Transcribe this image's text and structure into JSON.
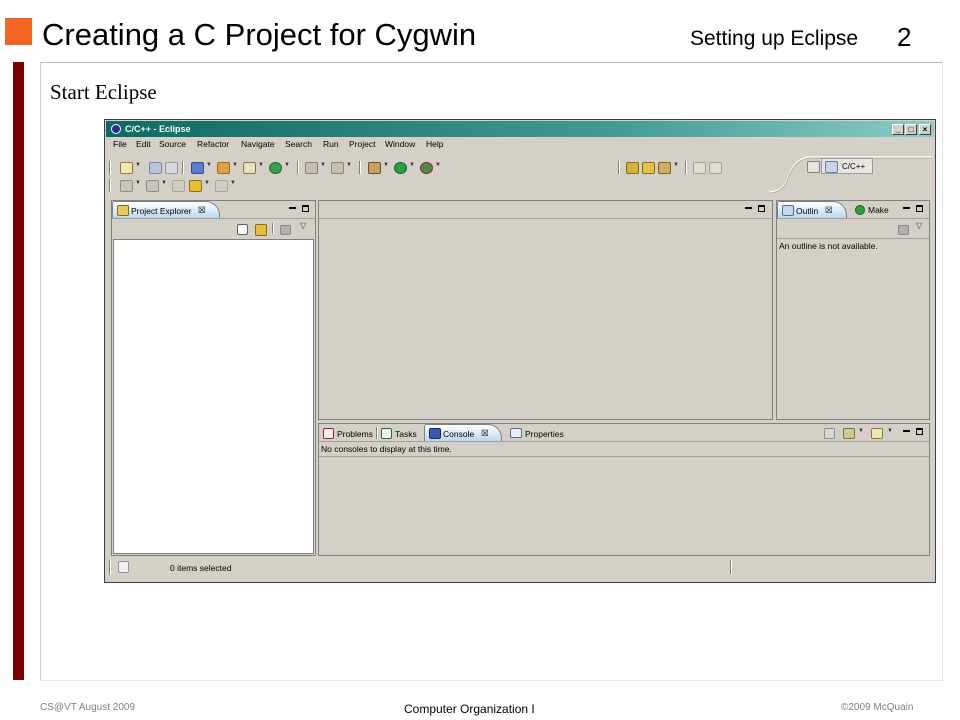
{
  "slide": {
    "title": "Creating a C Project for Cygwin",
    "topic": "Setting up Eclipse",
    "number": "2",
    "body": "Start Eclipse",
    "footer_left": "CS@VT August 2009",
    "footer_center": "Computer Organization I",
    "footer_right": "©2009  McQuain",
    "colors": {
      "accent_orange": "#f26522",
      "left_bar": "#7a0000"
    }
  },
  "window": {
    "title": "C/C++ - Eclipse",
    "title_icon": "eclipse-icon",
    "controls": {
      "minimize": "_",
      "maximize": "□",
      "close": "×"
    },
    "titlebar_color": "#0b6a61"
  },
  "menu": {
    "items": [
      "File",
      "Edit",
      "Source",
      "Refactor",
      "Navigate",
      "Search",
      "Run",
      "Project",
      "Window",
      "Help"
    ]
  },
  "perspective": {
    "label": "C/C++",
    "icon": "cpp-perspective-icon"
  },
  "project_explorer": {
    "tab": "Project Explorer",
    "close": "☒"
  },
  "outline": {
    "tab": "Outlin",
    "close": "☒",
    "message": "An outline is not available."
  },
  "make": {
    "tab": "Make"
  },
  "bottom_panel": {
    "tabs": [
      {
        "label": "Problems",
        "icon": "problems-icon"
      },
      {
        "label": "Tasks",
        "icon": "tasks-icon"
      },
      {
        "label": "Console",
        "icon": "console-icon",
        "active": true
      },
      {
        "label": "Properties",
        "icon": "properties-icon"
      }
    ],
    "console_close": "☒",
    "console_message": "No consoles to display at this time."
  },
  "status": {
    "text": "0 items selected"
  }
}
